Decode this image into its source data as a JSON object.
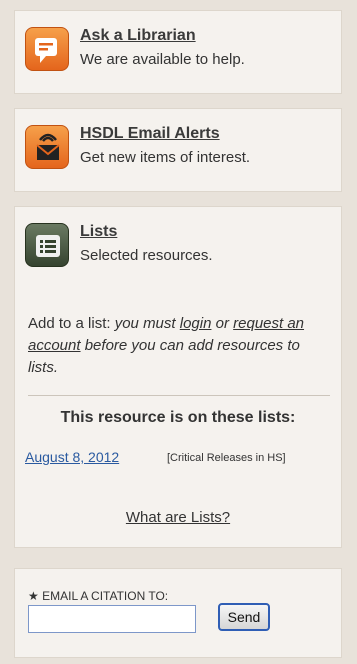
{
  "ask": {
    "title": "Ask a Librarian",
    "subtitle": "We are available to help.",
    "icon": "chat-bubble-icon"
  },
  "alerts": {
    "title": "HSDL Email Alerts",
    "subtitle": "Get new items of interest.",
    "icon": "email-alert-icon"
  },
  "lists": {
    "title": "Lists",
    "subtitle": "Selected resources.",
    "icon": "list-icon",
    "add_prefix": "Add to a list:",
    "must_text": " you must ",
    "login_link": "login",
    "or_text": " or ",
    "request_link": "request an account",
    "before_text": " before you can add resources to lists.",
    "on_lists_heading": "This resource is on these lists:",
    "list_item_link": "August 8, 2012",
    "list_item_tag": "[Critical Releases in HS]",
    "what_link": "What are Lists?"
  },
  "email": {
    "label": "EMAIL A CITATION TO:",
    "input_value": "",
    "send_label": "Send"
  },
  "colors": {
    "orange_icon": "#e4651c",
    "green_icon": "#35432f",
    "link_blue": "#2a5aa0"
  }
}
